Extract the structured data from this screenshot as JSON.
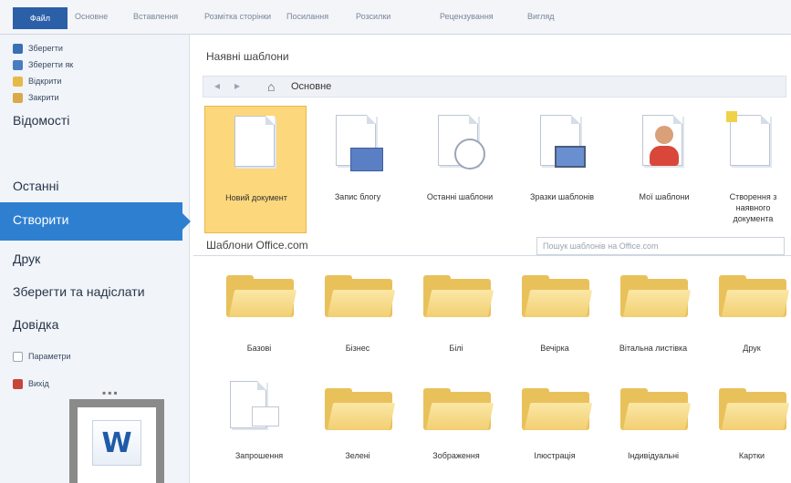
{
  "ribbon": {
    "file_tab": "Файл",
    "tabs": [
      "Основне",
      "Вставлення",
      "Розмітка сторінки",
      "Посилання",
      "Розсилки",
      "Рецензування",
      "Вигляд"
    ]
  },
  "sidebar": {
    "commands": [
      "Зберегти",
      "Зберегти як",
      "Відкрити",
      "Закрити"
    ],
    "sections": {
      "info": "Відомості",
      "recent": "Останні",
      "create": "Створити",
      "print": "Друк",
      "save_send": "Зберегти та надіслати",
      "help": "Довідка"
    },
    "bottom": [
      "Параметри",
      "Вихід"
    ],
    "logo_letter": "W"
  },
  "main": {
    "title": "Наявні шаблони",
    "nav_location": "Основне",
    "templates": [
      {
        "label": "Новий документ",
        "icon": "blank-document-icon",
        "selected": true
      },
      {
        "label": "Запис блогу",
        "icon": "blog-post-icon"
      },
      {
        "label": "Останні шаблони",
        "icon": "recent-templates-icon"
      },
      {
        "label": "Зразки шаблонів",
        "icon": "sample-templates-icon"
      },
      {
        "label": "Мої шаблони",
        "icon": "my-templates-icon"
      },
      {
        "label": "Створення з наявного документа",
        "icon": "new-from-existing-icon"
      }
    ],
    "office_title": "Шаблони Office.com",
    "search_placeholder": "Пошук шаблонів на Office.com",
    "folders_row1": [
      "Базові",
      "Бізнес",
      "Білі",
      "Вечірка",
      "Вітальна листівка",
      "Друк"
    ],
    "folders_row2": [
      "Запрошення",
      "Зелені",
      "Зображення",
      "Ілюстрація",
      "Індивідуальні",
      "Картки"
    ]
  },
  "colors": {
    "accent": "#2f7fd1",
    "file_tab": "#2b5fa8",
    "selected_tile": "#fcd77c",
    "folder": "#e9c15b"
  }
}
